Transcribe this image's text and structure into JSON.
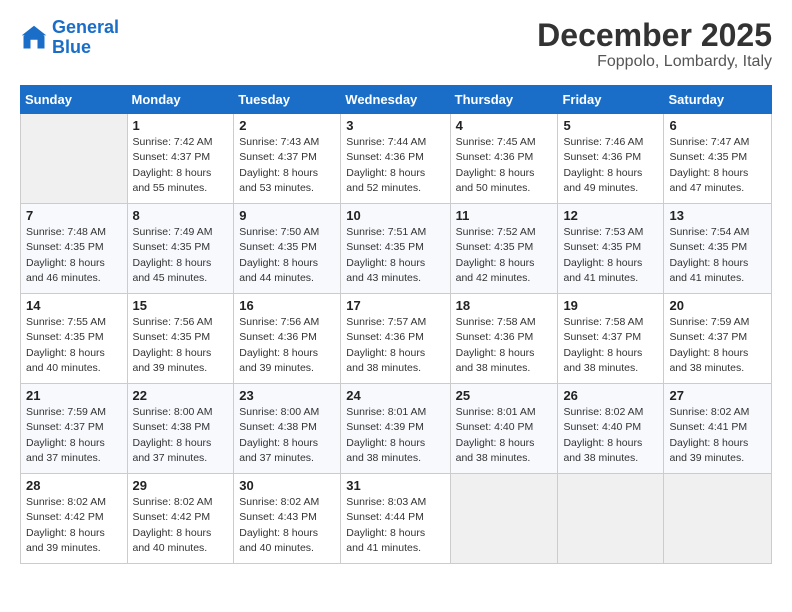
{
  "header": {
    "logo_line1": "General",
    "logo_line2": "Blue",
    "month": "December 2025",
    "location": "Foppolo, Lombardy, Italy"
  },
  "days_of_week": [
    "Sunday",
    "Monday",
    "Tuesday",
    "Wednesday",
    "Thursday",
    "Friday",
    "Saturday"
  ],
  "weeks": [
    [
      {
        "day": "",
        "info": ""
      },
      {
        "day": "1",
        "info": "Sunrise: 7:42 AM\nSunset: 4:37 PM\nDaylight: 8 hours\nand 55 minutes."
      },
      {
        "day": "2",
        "info": "Sunrise: 7:43 AM\nSunset: 4:37 PM\nDaylight: 8 hours\nand 53 minutes."
      },
      {
        "day": "3",
        "info": "Sunrise: 7:44 AM\nSunset: 4:36 PM\nDaylight: 8 hours\nand 52 minutes."
      },
      {
        "day": "4",
        "info": "Sunrise: 7:45 AM\nSunset: 4:36 PM\nDaylight: 8 hours\nand 50 minutes."
      },
      {
        "day": "5",
        "info": "Sunrise: 7:46 AM\nSunset: 4:36 PM\nDaylight: 8 hours\nand 49 minutes."
      },
      {
        "day": "6",
        "info": "Sunrise: 7:47 AM\nSunset: 4:35 PM\nDaylight: 8 hours\nand 47 minutes."
      }
    ],
    [
      {
        "day": "7",
        "info": "Sunrise: 7:48 AM\nSunset: 4:35 PM\nDaylight: 8 hours\nand 46 minutes."
      },
      {
        "day": "8",
        "info": "Sunrise: 7:49 AM\nSunset: 4:35 PM\nDaylight: 8 hours\nand 45 minutes."
      },
      {
        "day": "9",
        "info": "Sunrise: 7:50 AM\nSunset: 4:35 PM\nDaylight: 8 hours\nand 44 minutes."
      },
      {
        "day": "10",
        "info": "Sunrise: 7:51 AM\nSunset: 4:35 PM\nDaylight: 8 hours\nand 43 minutes."
      },
      {
        "day": "11",
        "info": "Sunrise: 7:52 AM\nSunset: 4:35 PM\nDaylight: 8 hours\nand 42 minutes."
      },
      {
        "day": "12",
        "info": "Sunrise: 7:53 AM\nSunset: 4:35 PM\nDaylight: 8 hours\nand 41 minutes."
      },
      {
        "day": "13",
        "info": "Sunrise: 7:54 AM\nSunset: 4:35 PM\nDaylight: 8 hours\nand 41 minutes."
      }
    ],
    [
      {
        "day": "14",
        "info": "Sunrise: 7:55 AM\nSunset: 4:35 PM\nDaylight: 8 hours\nand 40 minutes."
      },
      {
        "day": "15",
        "info": "Sunrise: 7:56 AM\nSunset: 4:35 PM\nDaylight: 8 hours\nand 39 minutes."
      },
      {
        "day": "16",
        "info": "Sunrise: 7:56 AM\nSunset: 4:36 PM\nDaylight: 8 hours\nand 39 minutes."
      },
      {
        "day": "17",
        "info": "Sunrise: 7:57 AM\nSunset: 4:36 PM\nDaylight: 8 hours\nand 38 minutes."
      },
      {
        "day": "18",
        "info": "Sunrise: 7:58 AM\nSunset: 4:36 PM\nDaylight: 8 hours\nand 38 minutes."
      },
      {
        "day": "19",
        "info": "Sunrise: 7:58 AM\nSunset: 4:37 PM\nDaylight: 8 hours\nand 38 minutes."
      },
      {
        "day": "20",
        "info": "Sunrise: 7:59 AM\nSunset: 4:37 PM\nDaylight: 8 hours\nand 38 minutes."
      }
    ],
    [
      {
        "day": "21",
        "info": "Sunrise: 7:59 AM\nSunset: 4:37 PM\nDaylight: 8 hours\nand 37 minutes."
      },
      {
        "day": "22",
        "info": "Sunrise: 8:00 AM\nSunset: 4:38 PM\nDaylight: 8 hours\nand 37 minutes."
      },
      {
        "day": "23",
        "info": "Sunrise: 8:00 AM\nSunset: 4:38 PM\nDaylight: 8 hours\nand 37 minutes."
      },
      {
        "day": "24",
        "info": "Sunrise: 8:01 AM\nSunset: 4:39 PM\nDaylight: 8 hours\nand 38 minutes."
      },
      {
        "day": "25",
        "info": "Sunrise: 8:01 AM\nSunset: 4:40 PM\nDaylight: 8 hours\nand 38 minutes."
      },
      {
        "day": "26",
        "info": "Sunrise: 8:02 AM\nSunset: 4:40 PM\nDaylight: 8 hours\nand 38 minutes."
      },
      {
        "day": "27",
        "info": "Sunrise: 8:02 AM\nSunset: 4:41 PM\nDaylight: 8 hours\nand 39 minutes."
      }
    ],
    [
      {
        "day": "28",
        "info": "Sunrise: 8:02 AM\nSunset: 4:42 PM\nDaylight: 8 hours\nand 39 minutes."
      },
      {
        "day": "29",
        "info": "Sunrise: 8:02 AM\nSunset: 4:42 PM\nDaylight: 8 hours\nand 40 minutes."
      },
      {
        "day": "30",
        "info": "Sunrise: 8:02 AM\nSunset: 4:43 PM\nDaylight: 8 hours\nand 40 minutes."
      },
      {
        "day": "31",
        "info": "Sunrise: 8:03 AM\nSunset: 4:44 PM\nDaylight: 8 hours\nand 41 minutes."
      },
      {
        "day": "",
        "info": ""
      },
      {
        "day": "",
        "info": ""
      },
      {
        "day": "",
        "info": ""
      }
    ]
  ]
}
